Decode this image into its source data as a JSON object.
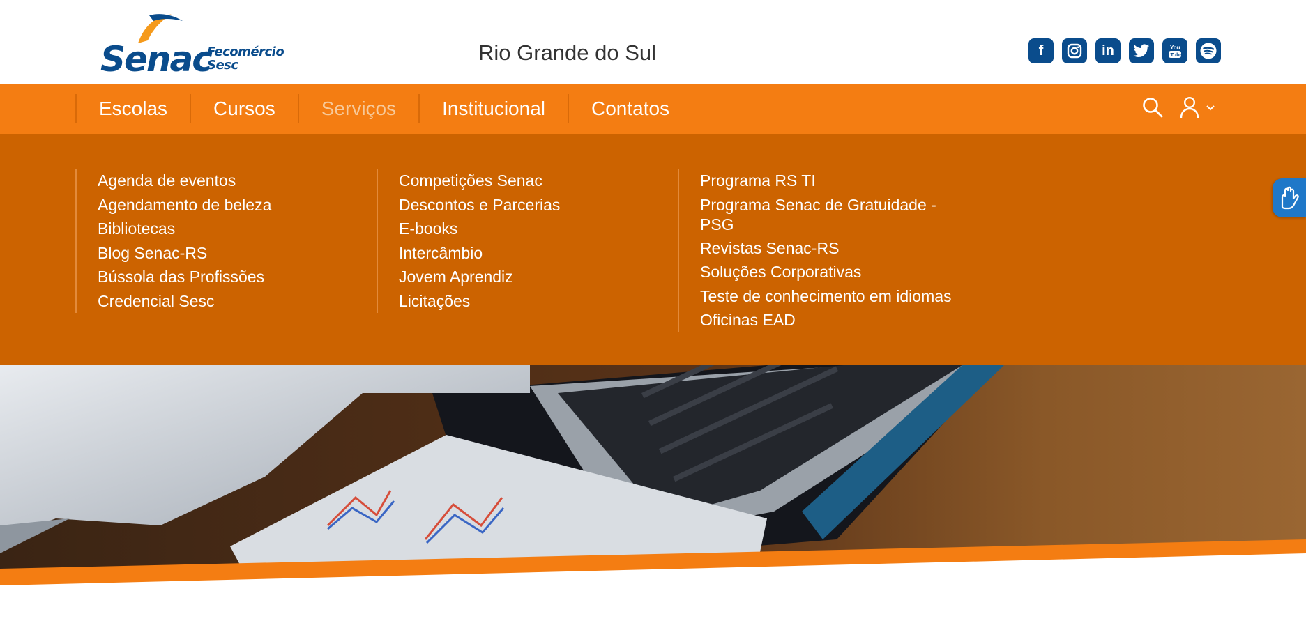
{
  "header": {
    "logo": {
      "wordmark": "Senac",
      "sub_line1": "Fecomércio",
      "sub_line2": "Sesc"
    },
    "region": "Rio Grande do Sul",
    "social": [
      {
        "name": "facebook",
        "icon": "facebook-icon",
        "glyph": "f"
      },
      {
        "name": "instagram",
        "icon": "instagram-icon",
        "glyph": ""
      },
      {
        "name": "linkedin",
        "icon": "linkedin-icon",
        "glyph": "in"
      },
      {
        "name": "twitter",
        "icon": "twitter-icon",
        "glyph": ""
      },
      {
        "name": "youtube",
        "icon": "youtube-icon",
        "glyph": ""
      },
      {
        "name": "spotify",
        "icon": "spotify-icon",
        "glyph": ""
      }
    ]
  },
  "nav": {
    "items": [
      {
        "label": "Escolas"
      },
      {
        "label": "Cursos"
      },
      {
        "label": "Serviços",
        "active": true
      },
      {
        "label": "Institucional"
      },
      {
        "label": "Contatos"
      }
    ],
    "tools": [
      "search-icon",
      "user-icon",
      "chevron-down-icon"
    ]
  },
  "menu": {
    "columns": [
      [
        "Agenda de eventos",
        "Agendamento de beleza",
        "Bibliotecas",
        "Blog Senac-RS",
        "Bússola das Profissões",
        "Credencial Sesc"
      ],
      [
        "Competições Senac",
        "Descontos e Parcerias",
        "E-books",
        "Intercâmbio",
        "Jovem Aprendiz",
        "Licitações"
      ],
      [
        "Programa RS TI",
        "Programa Senac de Gratuidade - PSG",
        "Revistas Senac-RS",
        "Soluções Corporativas",
        "Teste de conhecimento em idiomas",
        "Oficinas EAD"
      ]
    ]
  },
  "colors": {
    "brand_orange": "#f47d12",
    "menu_orange": "#cc6300",
    "brand_blue": "#0a4c8c",
    "accessibility_blue": "#1f78c8"
  },
  "widgets": {
    "accessibility": "sign-language-icon"
  }
}
